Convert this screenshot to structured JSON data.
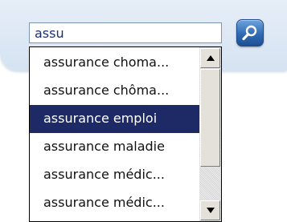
{
  "search": {
    "value": "assu",
    "button_icon": "magnifier-icon"
  },
  "suggestions": {
    "items": [
      {
        "label": "assurance choma..."
      },
      {
        "label": "assurance chôma..."
      },
      {
        "label": "assurance emploi"
      },
      {
        "label": "assurance maladie"
      },
      {
        "label": "assurance médic..."
      },
      {
        "label": "assurance médic..."
      }
    ],
    "selected_index": 2
  },
  "scrollbar": {
    "up_icon": "arrow-up-icon",
    "down_icon": "arrow-down-icon"
  },
  "colors": {
    "header_band": "#d5e3f2",
    "input_text": "#1c2f6e",
    "selected_bg": "#1e2a66",
    "selected_text": "#ffffff",
    "search_button": "#2f6bb5"
  }
}
